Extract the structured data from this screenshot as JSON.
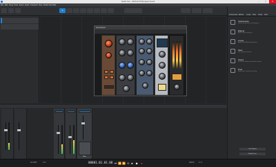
{
  "window": {
    "title": "Studio One - 2018-02-05 Bompass Sound",
    "minimize": "–",
    "maximize": "□",
    "close": "✕"
  },
  "menu": [
    "File",
    "Edit",
    "Song",
    "Track",
    "Event",
    "Audio",
    "Transport",
    "View",
    "Studio One",
    "Help"
  ],
  "browser": {
    "tabs": [
      "Instruments",
      "Effects",
      "Loops",
      "Files",
      "Cloud",
      "Pool"
    ],
    "items": [
      {
        "label": "Instruments",
        "desc": "Virtual instruments and plug-ins"
      },
      {
        "label": "Effects",
        "desc": "Audio effects plug-ins"
      },
      {
        "label": "Loops",
        "desc": "Audio and MIDI loop libraries"
      },
      {
        "label": "Files",
        "desc": "File system browser"
      },
      {
        "label": "Cloud",
        "desc": "PreSonus Shop and Cloud content"
      },
      {
        "label": "Pool",
        "desc": "Audio files used in the Song"
      }
    ],
    "buttons": [
      "Get Started",
      "Studio One+"
    ]
  },
  "plugin": {
    "title": "Fat Channel"
  },
  "console": {
    "channels": [
      "Main"
    ]
  },
  "transport": {
    "time": "00001.01.01.00",
    "sample_rate": "44.1 kHz",
    "record_time": "1 hr",
    "tempo": "120.00",
    "signature": "4 / 4"
  }
}
